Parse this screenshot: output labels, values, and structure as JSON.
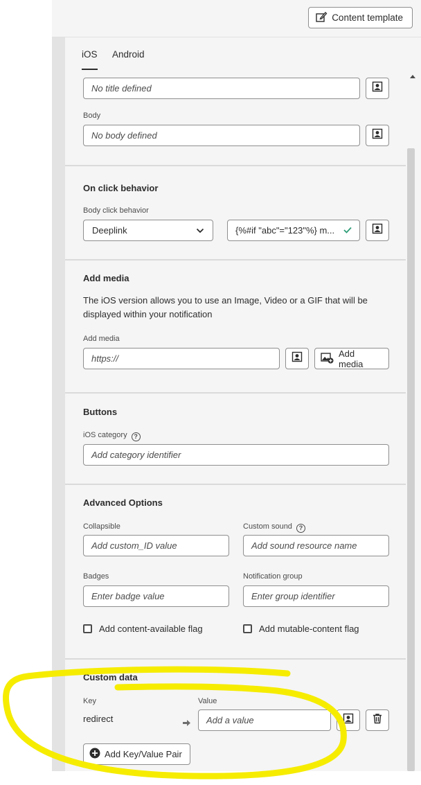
{
  "header": {
    "content_template_label": "Content template"
  },
  "tabs": [
    {
      "label": "iOS",
      "active": true
    },
    {
      "label": "Android",
      "active": false
    }
  ],
  "title_section": {
    "title_placeholder": "No title defined",
    "body_label": "Body",
    "body_placeholder": "No body defined"
  },
  "on_click": {
    "heading": "On click behavior",
    "body_click_label": "Body click behavior",
    "behavior_value": "Deeplink",
    "deeplink_value": "{%#if \"abc\"=\"123\"%} m..."
  },
  "add_media": {
    "heading": "Add media",
    "description_line1": "The iOS version allows you to use an Image, Video or a GIF that will be",
    "description_line2": "displayed within your notification",
    "field_label": "Add media",
    "url_placeholder": "https://",
    "button_label": "Add media"
  },
  "buttons": {
    "heading": "Buttons",
    "category_label": "iOS category",
    "category_placeholder": "Add category identifier"
  },
  "advanced": {
    "heading": "Advanced Options",
    "collapsible_label": "Collapsible",
    "collapsible_placeholder": "Add custom_ID value",
    "custom_sound_label": "Custom sound",
    "custom_sound_placeholder": "Add sound resource name",
    "badges_label": "Badges",
    "badges_placeholder": "Enter badge value",
    "notification_group_label": "Notification group",
    "notification_group_placeholder": "Enter group identifier",
    "content_available_label": "Add content-available flag",
    "mutable_content_label": "Add mutable-content flag"
  },
  "custom_data": {
    "heading": "Custom data",
    "key_header": "Key",
    "value_header": "Value",
    "rows": [
      {
        "key": "redirect",
        "value_placeholder": "Add a value"
      }
    ],
    "add_pair_label": "Add Key/Value Pair"
  },
  "colors": {
    "highlight": "#f5ec00",
    "checkmark": "#2d9d78",
    "panel_bg": "#f5f5f5",
    "border": "#8e8e8e"
  }
}
